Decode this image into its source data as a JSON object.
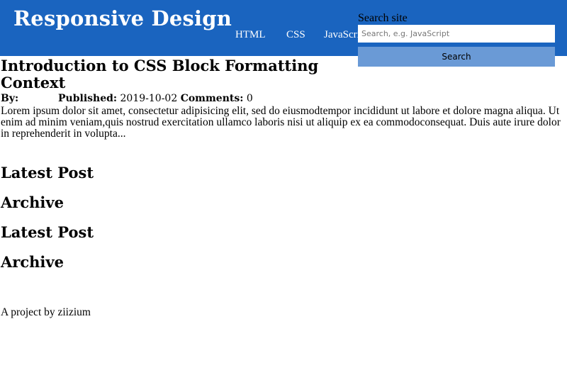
{
  "header": {
    "logo": "Responsive Design",
    "nav": [
      "HTML",
      "CSS",
      "JavaScript"
    ],
    "search": {
      "label": "Search site",
      "placeholder": "Search, e.g. JavaScript",
      "button": "Search"
    }
  },
  "article": {
    "title": "Introduction to CSS Block Formatting Context",
    "by_label": "By:",
    "published_label": "Published:",
    "published_value": "2019-10-02",
    "comments_label": "Comments:",
    "comments_value": "0",
    "excerpt": "Lorem ipsum dolor sit amet, consectetur adipisicing elit, sed do eiusmodtempor incididunt ut labore et dolore magna aliqua. Ut enim ad minim veniam,quis nostrud exercitation ullamco laboris nisi ut aliquip ex ea commodoconsequat. Duis aute irure dolor in reprehenderit in volupta..."
  },
  "sidebar": {
    "headings": [
      "Latest Post",
      "Archive",
      "Latest Post",
      "Archive"
    ]
  },
  "footer": {
    "text": "A project by ziizium"
  },
  "colors": {
    "header_bg": "#1a64bf",
    "search_button_bg": "#6a9ad6"
  }
}
